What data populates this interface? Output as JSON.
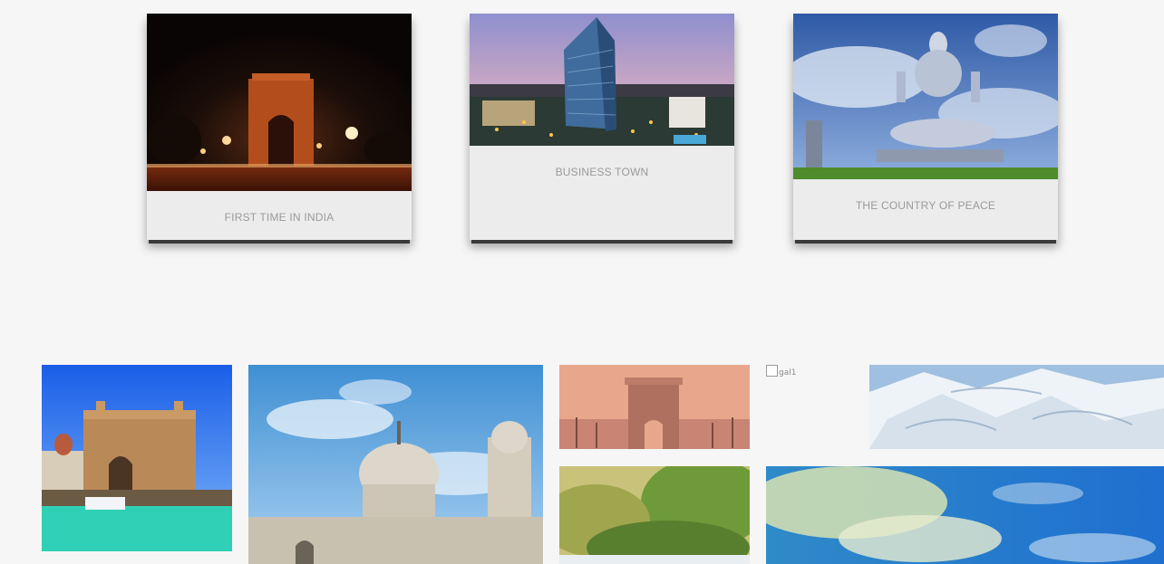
{
  "cards": [
    {
      "caption": "FIRST TIME IN INDIA",
      "image": "india-gate-night"
    },
    {
      "caption": "BUSINESS TOWN",
      "image": "skyscraper-city"
    },
    {
      "caption": "THE COUNTRY OF PEACE",
      "image": "shiva-statue"
    }
  ],
  "gallery": {
    "broken_image_alt": "gal1",
    "images": [
      "gateway-of-india",
      "victoria-memorial",
      "india-gate-sunset",
      "green-hills",
      "snow-mountains",
      "cloudy-sky"
    ]
  }
}
